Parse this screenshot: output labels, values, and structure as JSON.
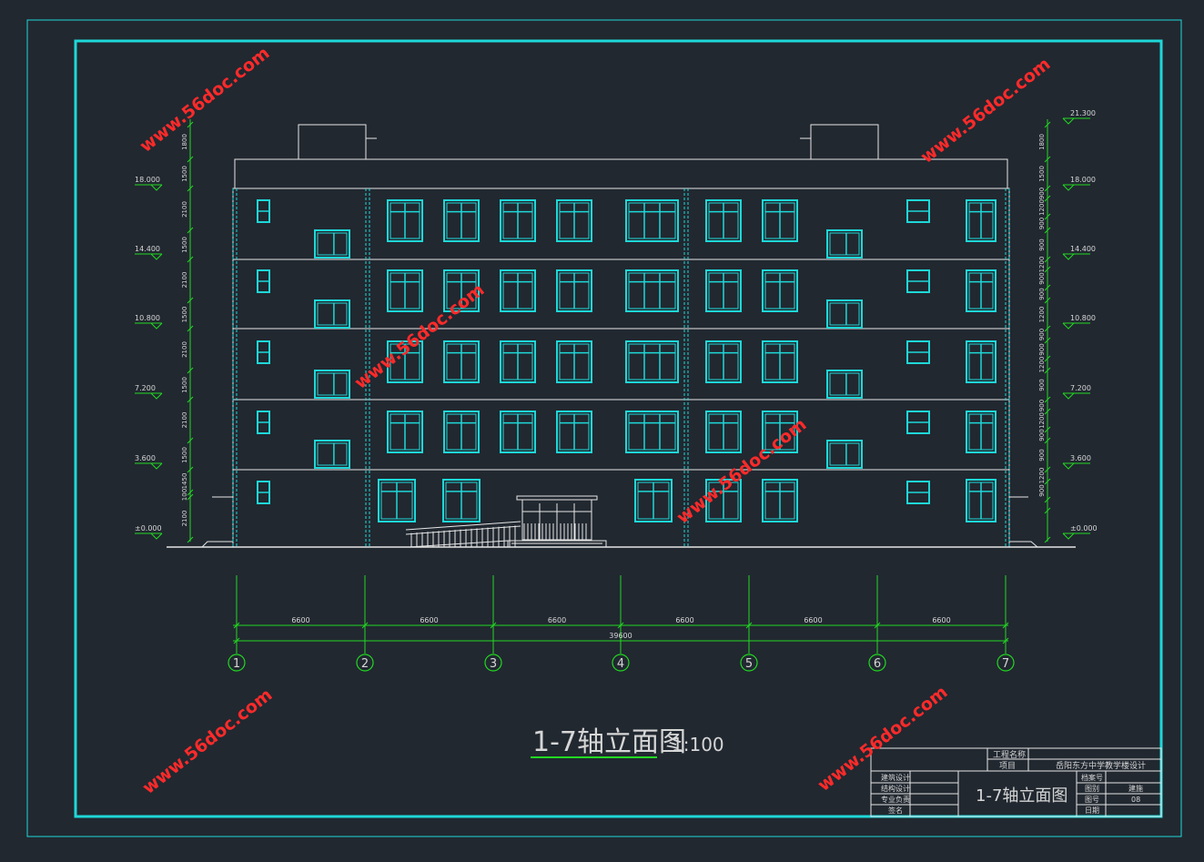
{
  "drawing": {
    "title": "1-7轴立面图",
    "scale": "1:100"
  },
  "elevations_left": [
    "18.000",
    "14.400",
    "10.800",
    "7.200",
    "3.600",
    "±0.000"
  ],
  "elevations_right": [
    "21.300",
    "18.000",
    "14.400",
    "10.800",
    "7.200",
    "3.600",
    "±0.000"
  ],
  "dims_left": [
    "1800",
    "1500",
    "2100",
    "1500",
    "2100",
    "1500",
    "2100",
    "1500",
    "2100",
    "1500",
    "1450",
    "100",
    "2100"
  ],
  "dims_right": [
    "1800",
    "1500",
    "900",
    "1200",
    "900",
    "900",
    "1200",
    "900",
    "900",
    "1200",
    "900",
    "900",
    "1200",
    "900",
    "900",
    "1200",
    "900",
    "900",
    "1200",
    "900"
  ],
  "axes": [
    "1",
    "2",
    "3",
    "4",
    "5",
    "6",
    "7"
  ],
  "bay_dims": [
    "6600",
    "6600",
    "6600",
    "6600",
    "6600",
    "6600"
  ],
  "total_dim": "39600",
  "title_block": {
    "project_label": "工程名称",
    "item_label": "项目",
    "project_name": "岳阳东方中学教学楼设计",
    "drawing_name": "1-7轴立面图",
    "left_rows": [
      "建筑设计",
      "结构设计",
      "专业负责",
      "签名"
    ],
    "right_labels": [
      "档案号",
      "图别",
      "图号",
      "日期"
    ],
    "right_values": [
      "",
      "建施",
      "08",
      ""
    ]
  },
  "watermark": "www.56doc.com",
  "colors": {
    "background": "#212830",
    "frame": "#1ed8d8",
    "outline": "#e6e6e6",
    "window": "#1ed8d8",
    "dimension": "#22d822",
    "watermark": "#ff2a2a"
  }
}
